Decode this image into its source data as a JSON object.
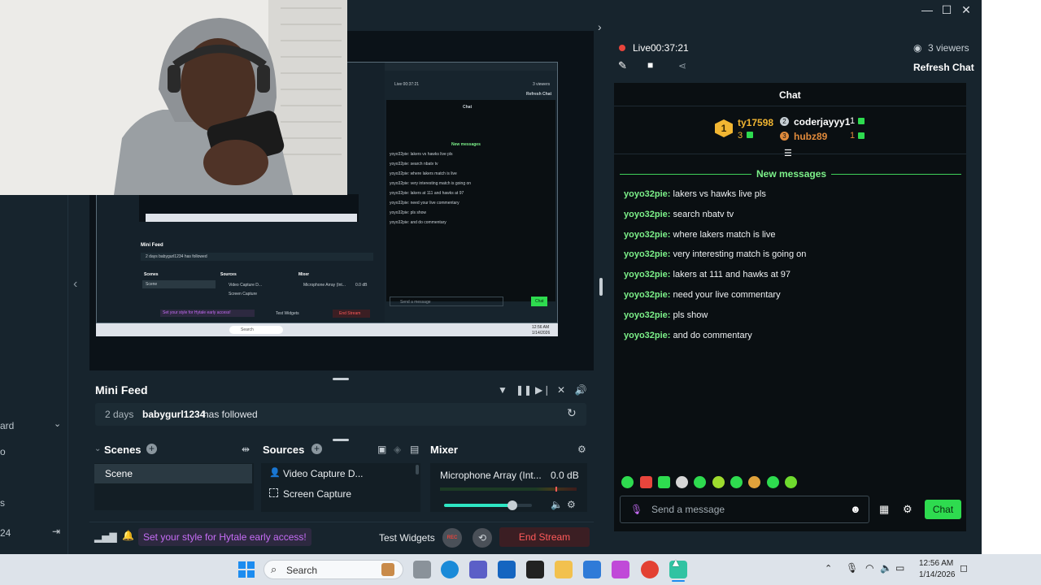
{
  "window": {
    "minimize_glyph": "—",
    "maximize_glyph": "☐",
    "close_glyph": "✕"
  },
  "chat_header": {
    "live_label": "Live",
    "live_time": "00:37:21",
    "viewers": "3 viewers",
    "refresh_label": "Refresh Chat",
    "title": "Chat"
  },
  "leaderboard": {
    "first": {
      "rank": "1",
      "name": "ty17598",
      "count": "3"
    },
    "second": {
      "rank": "2",
      "name": "coderjayyy1",
      "count": "1"
    },
    "third": {
      "rank": "3",
      "name": "hubz89",
      "count": "1"
    }
  },
  "chat": {
    "new_messages_label": "New messages",
    "messages": [
      {
        "user": "yoyo32pie:",
        "text": " lakers vs hawks live pls"
      },
      {
        "user": "yoyo32pie:",
        "text": " search nbatv tv"
      },
      {
        "user": "yoyo32pie:",
        "text": " where lakers match is live"
      },
      {
        "user": "yoyo32pie:",
        "text": " very interesting match is going on"
      },
      {
        "user": "yoyo32pie:",
        "text": " lakers at 111 and hawks at 97"
      },
      {
        "user": "yoyo32pie:",
        "text": " need your live commentary"
      },
      {
        "user": "yoyo32pie:",
        "text": " pls show"
      },
      {
        "user": "yoyo32pie:",
        "text": " and do commentary"
      }
    ],
    "input_placeholder": "Send a message",
    "send_label": "Chat"
  },
  "mini_feed": {
    "title": "Mini Feed",
    "row": {
      "time": "2 days",
      "user": "babygurl1234",
      "action": "has followed"
    }
  },
  "scenes": {
    "title": "Scenes",
    "items": [
      "Scene"
    ]
  },
  "sources": {
    "title": "Sources",
    "items": [
      "Video Capture D...",
      "Screen Capture"
    ]
  },
  "mixer": {
    "title": "Mixer",
    "device": "Microphone Array (Int...",
    "level": "0.0 dB",
    "volume_fraction": 0.78
  },
  "footer": {
    "promo": "Set your style for Hytale early access!",
    "test_widgets": "Test Widgets",
    "rec_label": "REC",
    "end_stream": "End Stream"
  },
  "left_sidebar": {
    "labels": [
      "ard",
      "o",
      "s",
      "24"
    ]
  },
  "taskbar": {
    "search_placeholder": "Search",
    "time": "12:56 AM",
    "date": "1/14/2026"
  },
  "nested_preview": {
    "live": "Live 00:37:21",
    "viewers": "3 viewers",
    "refresh": "Refresh Chat",
    "chat": "Chat",
    "new_messages": "New messages",
    "lines": [
      "yoyo32pie: lakers vs hawks live pls",
      "yoyo32pie: search nbatv tv",
      "yoyo32pie: where lakers match is live",
      "yoyo32pie: very interesting match is going on",
      "yoyo32pie: lakers at 111 and hawks at 97",
      "yoyo32pie: need your live commentary",
      "yoyo32pie: pls show",
      "yoyo32pie: and do commentary"
    ],
    "mini_feed": "Mini Feed",
    "feed_row": "2 days  babygurl1234  has followed",
    "scenes": "Scenes",
    "sources": "Sources",
    "mixer": "Mixer",
    "scene": "Scene",
    "source1": "Video Capture D...",
    "source2": "Screen Capture",
    "mic": "Microphone Array (Int...",
    "db": "0.0 dB",
    "promo": "Set your style for Hytale early access!",
    "test_widgets": "Test Widgets",
    "end_stream": "End Stream",
    "send": "Send a message",
    "chat_btn": "Chat",
    "search": "Search",
    "time": "12:56 AM",
    "date": "1/14/2026"
  },
  "colors": {
    "app_bg": "#17242d",
    "chat_bg": "#0a0f12",
    "accent_green": "#2edb4f",
    "username_green": "#7cf089",
    "live_red": "#e8453c",
    "promo_purple": "#c66cf5",
    "end_stream_red": "#ff5a5a"
  }
}
